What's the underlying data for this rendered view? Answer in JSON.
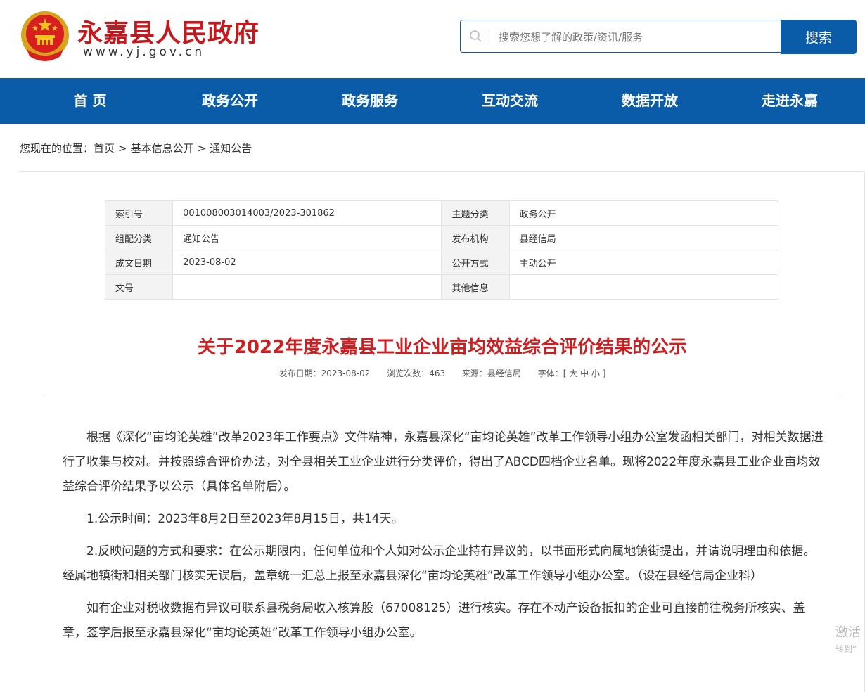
{
  "header": {
    "site_title": "永嘉县人民政府",
    "site_url": "www.yj.gov.cn",
    "search_placeholder": "搜索您想了解的政策/资讯/服务",
    "search_button": "搜索"
  },
  "nav": {
    "items": [
      "首 页",
      "政务公开",
      "政务服务",
      "互动交流",
      "数据开放",
      "走进永嘉"
    ]
  },
  "breadcrumb": {
    "prefix": "您现在的位置：",
    "items": [
      "首页",
      "基本信息公开",
      "通知公告"
    ],
    "separator": ">"
  },
  "meta_table": {
    "rows": [
      [
        "索引号",
        "001008003014003/2023-301862",
        "主题分类",
        "政务公开"
      ],
      [
        "组配分类",
        "通知公告",
        "发布机构",
        "县经信局"
      ],
      [
        "成文日期",
        "2023-08-02",
        "公开方式",
        "主动公开"
      ],
      [
        "文号",
        "",
        "其他信息",
        ""
      ]
    ]
  },
  "article": {
    "title": "关于2022年度永嘉县工业企业亩均效益综合评价结果的公示",
    "publish_date": "发布日期：2023-08-02",
    "views": "浏览次数：463",
    "source": "来源：县经信局",
    "font_size": "字体：[ 大 中 小 ]",
    "paragraphs": [
      "根据《深化“亩均论英雄”改革2023年工作要点》文件精神，永嘉县深化“亩均论英雄”改革工作领导小组办公室发函相关部门，对相关数据进行了收集与校对。并按照综合评价办法，对全县相关工业企业进行分类评价，得出了ABCD四档企业名单。现将2022年度永嘉县工业企业亩均效益综合评价结果予以公示（具体名单附后）。",
      "1.公示时间：2023年8月2日至2023年8月15日，共14天。",
      "2.反映问题的方式和要求：在公示期限内，任何单位和个人如对公示企业持有异议的，以书面形式向属地镇街提出，并请说明理由和依据。经属地镇街和相关部门核实无误后，盖章统一汇总上报至永嘉县深化“亩均论英雄”改革工作领导小组办公室。（设在县经信局企业科）",
      "如有企业对税收数据有异议可联系县税务局收入核算股（67008125）进行核实。存在不动产设备抵扣的企业可直接前往税务所核实、盖章，签字后报至永嘉县深化“亩均论英雄”改革工作领导小组办公室。"
    ]
  },
  "watermark": {
    "line1": "激活",
    "line2": "转到“"
  },
  "colors": {
    "brand_blue": "#0b5ca8",
    "title_red": "#d01d1f",
    "site_title_red": "#c4181c"
  }
}
